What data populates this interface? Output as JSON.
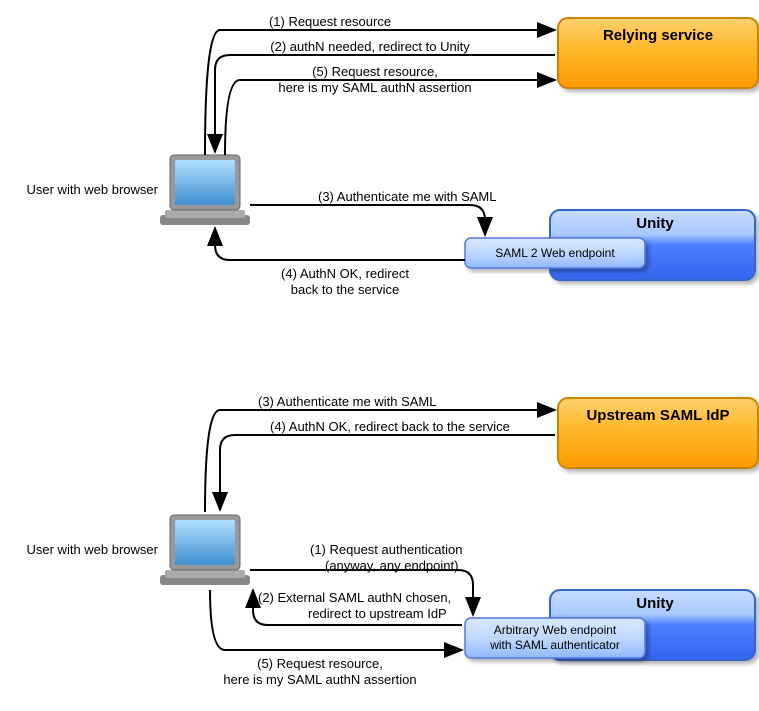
{
  "top": {
    "user_label": "User with web browser",
    "relying": "Relying service",
    "unity": "Unity",
    "endpoint": "SAML 2 Web endpoint",
    "arrows": {
      "a1": "(1) Request resource",
      "a2": "(2) authN needed, redirect to Unity",
      "a5a": "(5) Request resource,",
      "a5b": "here is my SAML authN assertion",
      "a3": "(3) Authenticate me with SAML",
      "a4a": "(4) AuthN OK, redirect",
      "a4b": "back to the service"
    }
  },
  "bottom": {
    "user_label": "User with web browser",
    "idp": "Upstream SAML IdP",
    "unity": "Unity",
    "endpoint1": "Arbitrary Web endpoint",
    "endpoint2": "with SAML authenticator",
    "arrows": {
      "a3": "(3) Authenticate me with SAML",
      "a4": "(4) AuthN OK, redirect back to the service",
      "a1a": "(1) Request authentication",
      "a1b": "(anyway, any endpoint)",
      "a2a": "(2) External SAML authN chosen,",
      "a2b": "redirect to upstream IdP",
      "a5a": "(5) Request resource,",
      "a5b": "here is my SAML authN assertion"
    }
  }
}
